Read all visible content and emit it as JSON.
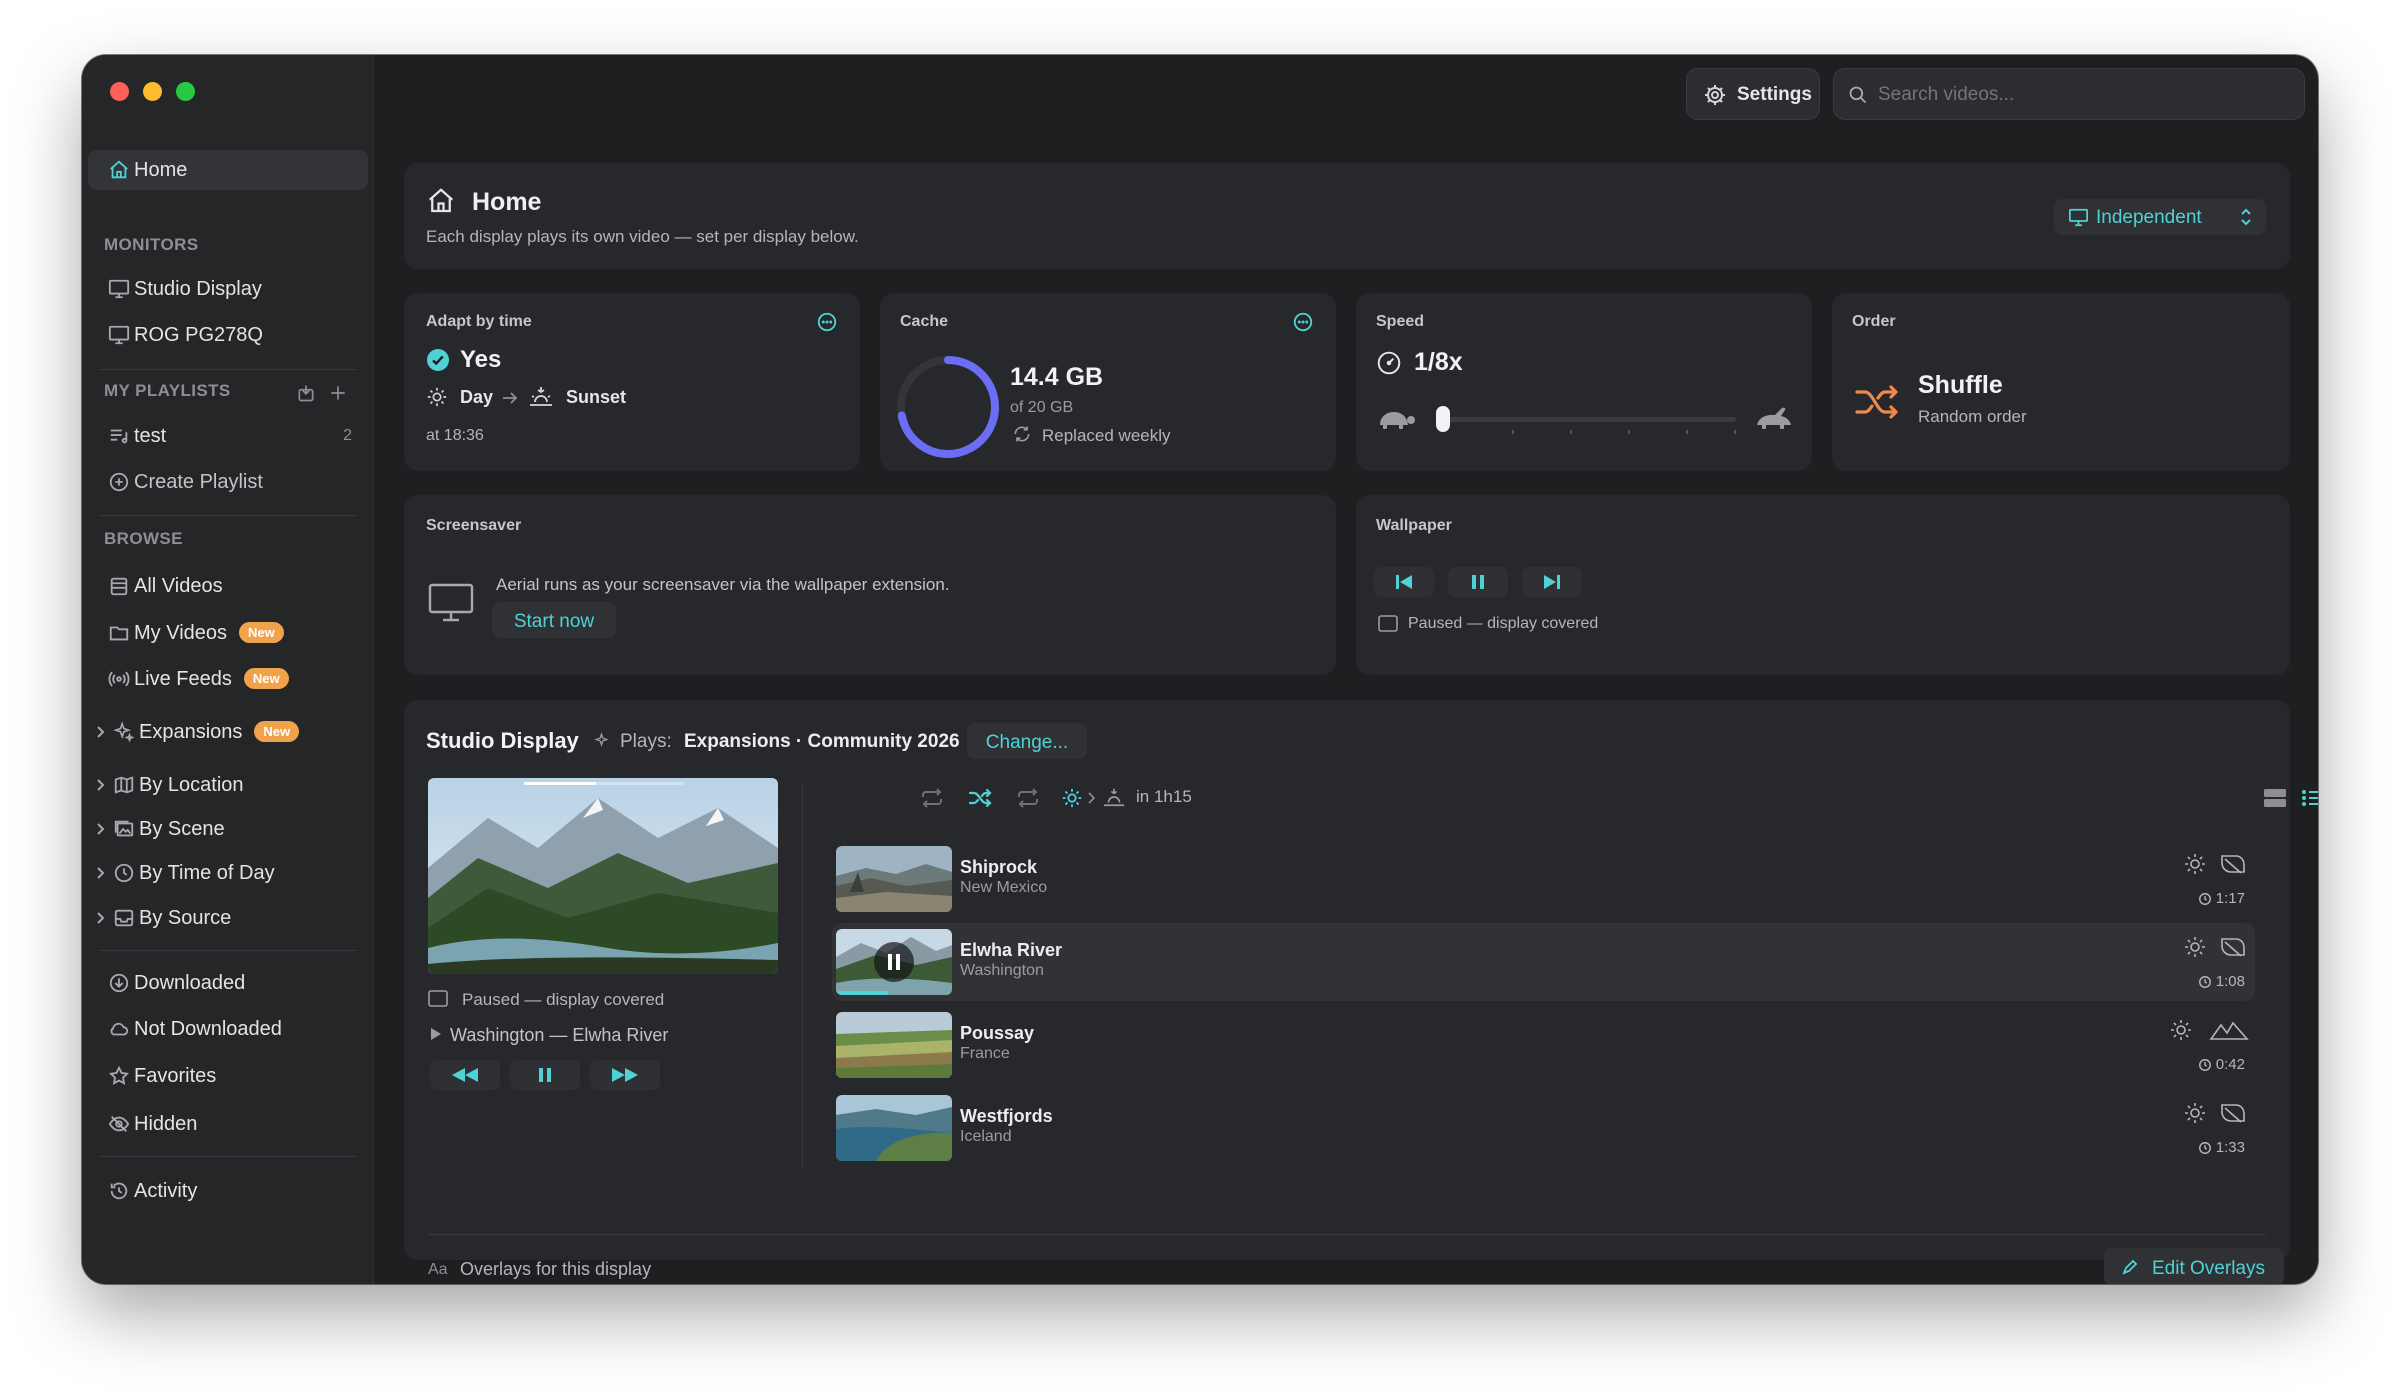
{
  "topbar": {
    "settings_label": "Settings",
    "search_placeholder": "Search videos..."
  },
  "sidebar": {
    "home": "Home",
    "monitors_header": "MONITORS",
    "monitors": [
      "Studio Display",
      "ROG PG278Q"
    ],
    "playlists_header": "MY PLAYLISTS",
    "playlists": [
      {
        "name": "test",
        "count": "2"
      }
    ],
    "create_playlist": "Create Playlist",
    "browse_header": "BROWSE",
    "all_videos": "All Videos",
    "my_videos": "My Videos",
    "live_feeds": "Live Feeds",
    "expansions": "Expansions",
    "badge_new": "New",
    "by_location": "By Location",
    "by_scene": "By Scene",
    "by_time_of_day": "By Time of Day",
    "by_source": "By Source",
    "downloaded": "Downloaded",
    "not_downloaded": "Not Downloaded",
    "favorites": "Favorites",
    "hidden": "Hidden",
    "activity": "Activity"
  },
  "header": {
    "title": "Home",
    "subtitle": "Each display plays its own video — set per display below.",
    "mode": "Independent"
  },
  "cards": {
    "adapt": {
      "label": "Adapt by time",
      "value": "Yes",
      "from": "Day",
      "to": "Sunset",
      "time": "at 18:36"
    },
    "cache": {
      "label": "Cache",
      "used": "14.4 GB",
      "total": "of 20 GB",
      "note": "Replaced weekly",
      "fraction": 0.72
    },
    "speed": {
      "label": "Speed",
      "value": "1/8x",
      "slider_fraction": 0.0
    },
    "order": {
      "label": "Order",
      "value": "Shuffle",
      "sub": "Random order"
    },
    "screensaver": {
      "label": "Screensaver",
      "text": "Aerial runs as your screensaver via the wallpaper extension.",
      "button": "Start now"
    },
    "wallpaper": {
      "label": "Wallpaper",
      "status": "Paused — display covered"
    }
  },
  "display": {
    "name": "Studio Display",
    "plays_label": "Plays:",
    "plays_value": "Expansions · Community 2026",
    "change": "Change...",
    "status": "Paused — display covered",
    "now_playing": "Washington — Elwha River",
    "next_in": "in 1h15",
    "progress_fraction": 0.45,
    "overlays_label": "Overlays for this display",
    "edit_overlays": "Edit Overlays",
    "playlist": [
      {
        "title": "Shiprock",
        "sub": "New Mexico",
        "duration": "1:17"
      },
      {
        "title": "Elwha River",
        "sub": "Washington",
        "duration": "1:08",
        "playing": true,
        "progress_fraction": 0.45
      },
      {
        "title": "Poussay",
        "sub": "France",
        "duration": "0:42"
      },
      {
        "title": "Westfjords",
        "sub": "Iceland",
        "duration": "1:33"
      }
    ]
  },
  "colors": {
    "accent": "#4fd2d6",
    "badge": "#f0a34a",
    "ring": "#6b6ef5",
    "shuffle": "#f08a4b"
  }
}
